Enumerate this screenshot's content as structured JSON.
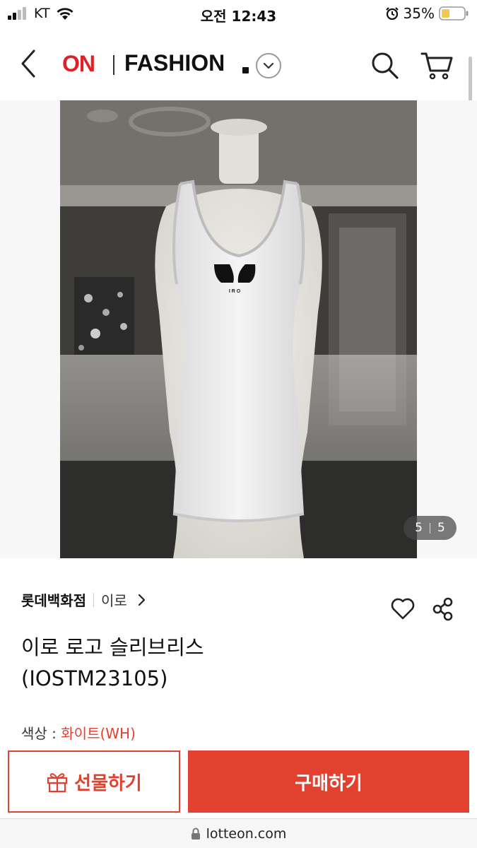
{
  "status_bar": {
    "carrier": "KT",
    "time": "오전 12:43",
    "battery": "35%"
  },
  "header": {
    "logo_on": "ON",
    "logo_fashion": "FASHION"
  },
  "gallery": {
    "current": "5",
    "total": "5",
    "logo_text": "I R O"
  },
  "product": {
    "store": "롯데백화점",
    "brand": "이로",
    "title_line1": "이로 로고 슬리브리스",
    "title_line2": "(IOSTM23105)",
    "color_label": "색상 : ",
    "color_value": "화이트(WH)"
  },
  "actions": {
    "gift_label": "선물하기",
    "buy_label": "구매하기"
  },
  "browser": {
    "url": "lotteon.com"
  },
  "colors": {
    "accent": "#e3412f",
    "logo_red": "#e21f26"
  }
}
